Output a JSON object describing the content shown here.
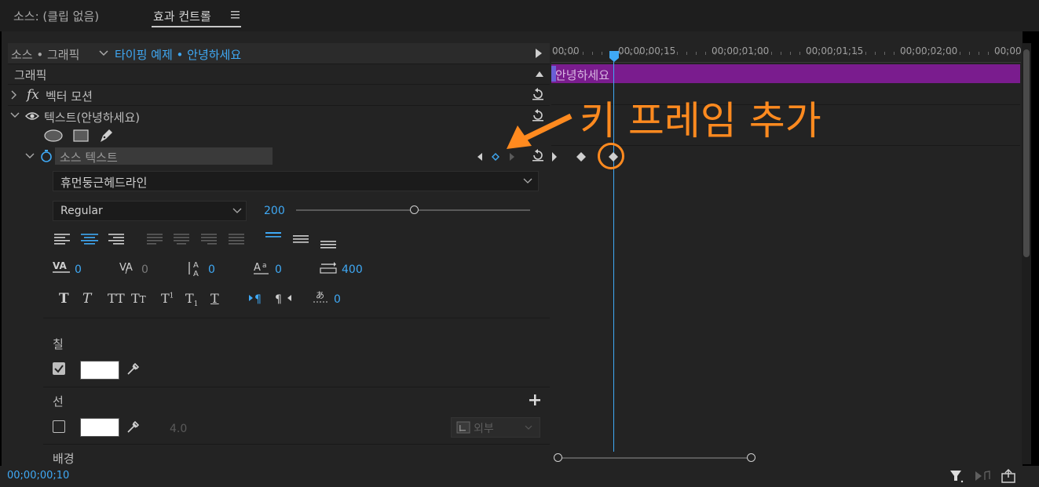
{
  "tabs": {
    "source": "소스: (클립 없음)",
    "effect_controls": "효과 컨트롤"
  },
  "header": {
    "source_label": "소스 • 그래픽",
    "sequence_clip": "타이핑 예제 • 안녕하세요"
  },
  "sections": {
    "graphic": "그래픽",
    "vector_motion": "벡터 모션",
    "text_layer": "텍스트(안녕하세요)",
    "source_text": "소스 텍스트"
  },
  "text_props": {
    "font": "휴먼둥근헤드라인",
    "style": "Regular",
    "size": "200",
    "kerning": "0",
    "tracking": "0",
    "leading": "0",
    "baseline": "0",
    "tsume": "400",
    "indent": "0"
  },
  "appearance": {
    "fill": "칠",
    "stroke": "선",
    "stroke_width": "4.0",
    "stroke_type": "외부",
    "background": "배경",
    "fill_checked": true,
    "stroke_checked": false,
    "fill_color": "#ffffff",
    "stroke_color": "#ffffff"
  },
  "timeline": {
    "ruler": [
      "00;00",
      "00;00;00;15",
      "00;00;01;00",
      "00;00;01;15",
      "00;00;02;00",
      "00;00"
    ],
    "clip_label": "안녕하세요",
    "clip_color": "#7a1c8e",
    "playhead_color": "#3fa9f5"
  },
  "annotation": {
    "text": "키 프레임 추가",
    "color": "#ff8a1f"
  },
  "footer": {
    "timecode": "00;00;00;10"
  }
}
